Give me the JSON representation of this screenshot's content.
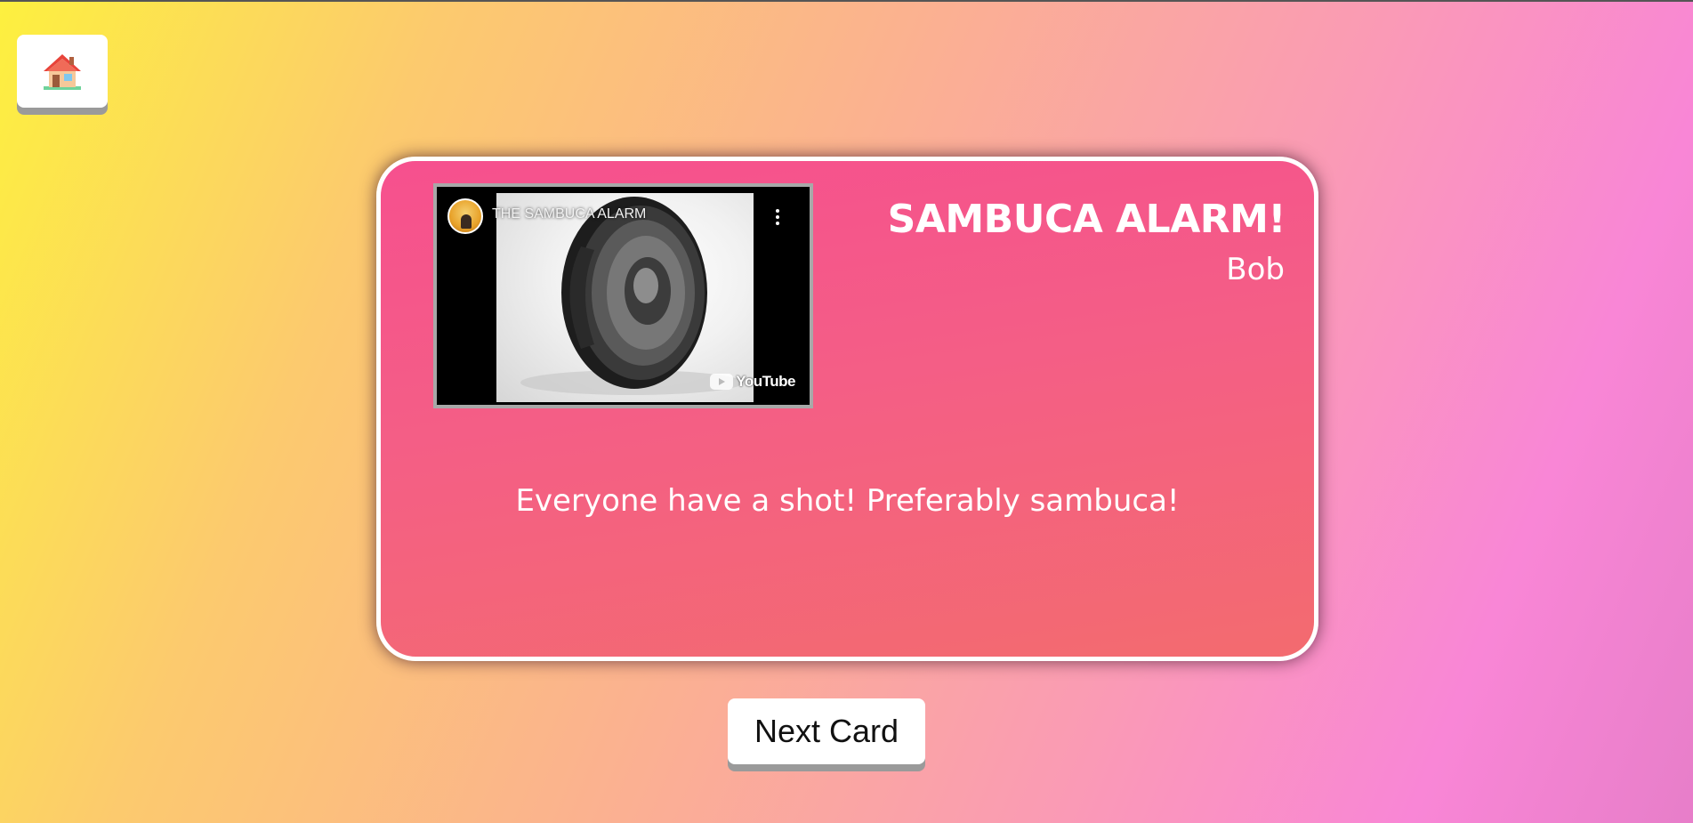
{
  "header": {
    "home_icon": "house-icon"
  },
  "card": {
    "title": "SAMBUCA ALARM!",
    "author": "Bob",
    "text": "Everyone have a shot! Preferably sambuca!",
    "video": {
      "title": "THE SAMBUCA ALARM",
      "provider_label": "YouTube",
      "channel_icon": "channel-avatar",
      "menu_icon": "more-vertical-icon",
      "thumbnail": "speaker-image"
    }
  },
  "controls": {
    "next_label": "Next Card"
  }
}
